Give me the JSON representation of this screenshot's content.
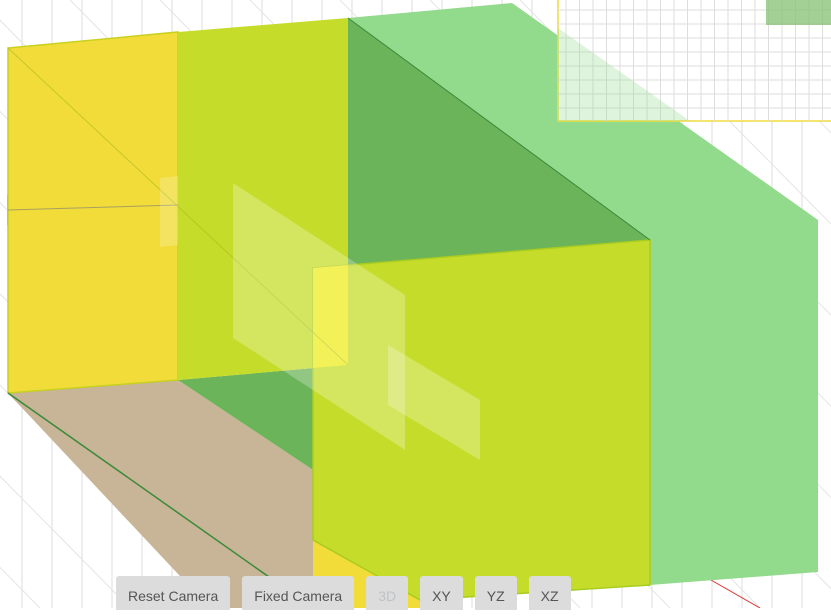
{
  "toolbar": {
    "buttons": [
      {
        "label": "Reset Camera",
        "enabled": true
      },
      {
        "label": "Fixed Camera",
        "enabled": true
      },
      {
        "label": "3D",
        "enabled": false
      },
      {
        "label": "XY",
        "enabled": true
      },
      {
        "label": "YZ",
        "enabled": true
      },
      {
        "label": "XZ",
        "enabled": true
      }
    ]
  },
  "colors": {
    "yellow_face": "#f2dc3a",
    "lime_face": "#c6dc2a",
    "green_face": "#92da8c",
    "dark_green": "#6cb45a",
    "brown_face": "#c8b496",
    "grid": "#d8d8d8",
    "inset_border": "#f2dc3a"
  }
}
